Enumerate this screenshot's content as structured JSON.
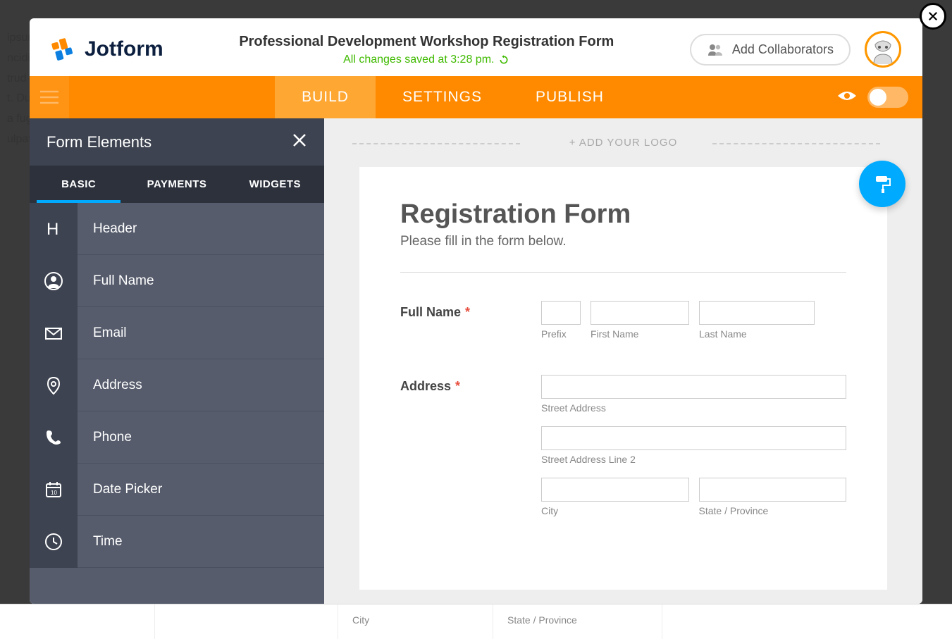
{
  "brand": "Jotform",
  "header": {
    "title": "Professional Development Workshop Registration Form",
    "save_status": "All changes saved at 3:28 pm.",
    "collab_label": "Add Collaborators"
  },
  "nav": {
    "tabs": [
      {
        "label": "BUILD",
        "active": true
      },
      {
        "label": "SETTINGS",
        "active": false
      },
      {
        "label": "PUBLISH",
        "active": false
      }
    ]
  },
  "sidebar": {
    "title": "Form Elements",
    "tabs": [
      {
        "label": "BASIC",
        "active": true
      },
      {
        "label": "PAYMENTS",
        "active": false
      },
      {
        "label": "WIDGETS",
        "active": false
      }
    ],
    "elements": [
      {
        "icon": "header",
        "label": "Header"
      },
      {
        "icon": "user",
        "label": "Full Name"
      },
      {
        "icon": "email",
        "label": "Email"
      },
      {
        "icon": "pin",
        "label": "Address"
      },
      {
        "icon": "phone",
        "label": "Phone"
      },
      {
        "icon": "calendar",
        "label": "Date Picker"
      },
      {
        "icon": "clock",
        "label": "Time"
      }
    ]
  },
  "canvas": {
    "logo_drop": "+ ADD YOUR LOGO",
    "form_title": "Registration Form",
    "form_subtitle": "Please fill in the form below.",
    "fields": {
      "fullname": {
        "label": "Full Name",
        "required": true,
        "sub": {
          "prefix": "Prefix",
          "first": "First Name",
          "last": "Last Name"
        }
      },
      "address": {
        "label": "Address",
        "required": true,
        "sub": {
          "street1": "Street Address",
          "street2": "Street Address Line 2",
          "city": "City",
          "state": "State / Province"
        }
      }
    }
  },
  "bg_row": {
    "city": "City",
    "state": "State / Province"
  }
}
